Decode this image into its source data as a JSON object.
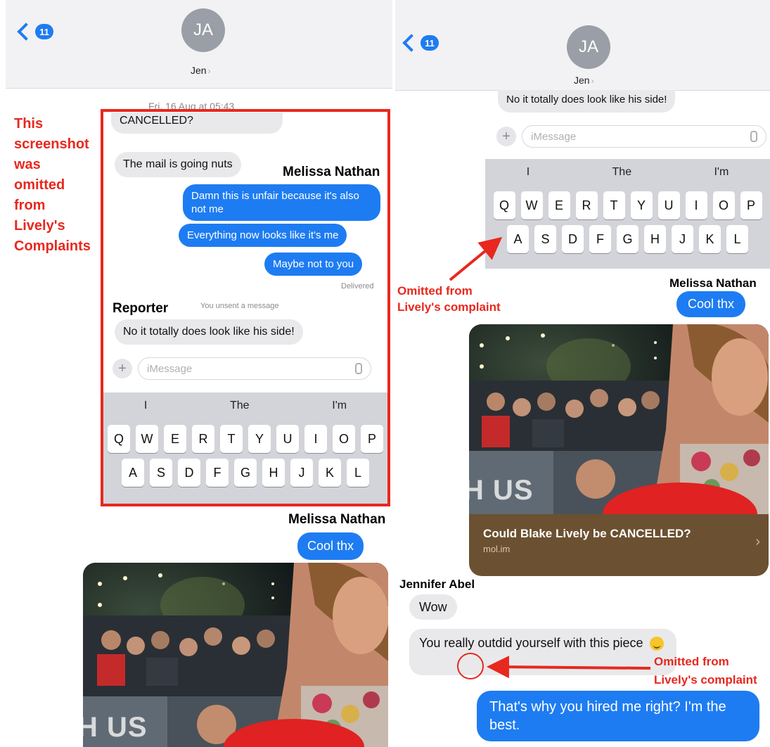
{
  "left": {
    "back_count": "11",
    "avatar_initials": "JA",
    "contact_name": "Jen",
    "timestamp": "Fri, 16 Aug at 05:43",
    "messages": {
      "cancelled": "CANCELLED?",
      "mail": "The mail is going nuts",
      "unfair": "Damn this is unfair because it's also not me",
      "everything": "Everything now looks like it's me",
      "maybe": "Maybe not to you",
      "delivered": "Delivered",
      "unsent": "You unsent a message",
      "totally": "No it totally does look like his side!",
      "cool": "Cool thx"
    },
    "compose_placeholder": "iMessage",
    "keyboard": {
      "suggestions": [
        "I",
        "The",
        "I'm"
      ],
      "row1": [
        "Q",
        "W",
        "E",
        "R",
        "T",
        "Y",
        "U",
        "I",
        "O",
        "P"
      ],
      "row2": [
        "A",
        "S",
        "D",
        "F",
        "G",
        "H",
        "J",
        "K",
        "L"
      ]
    },
    "photo_overlay": "H US"
  },
  "right": {
    "back_count": "11",
    "avatar_initials": "JA",
    "contact_name": "Jen",
    "messages": {
      "totally": "No it totally does look like his side!",
      "cool": "Cool thx",
      "wow": "Wow",
      "outdid": "You really outdid yourself with this piece",
      "hired": "That's why you hired  me right? I'm the best."
    },
    "compose_placeholder": "iMessage",
    "keyboard": {
      "suggestions": [
        "I",
        "The",
        "I'm"
      ],
      "row1": [
        "Q",
        "W",
        "E",
        "R",
        "T",
        "Y",
        "U",
        "I",
        "O",
        "P"
      ],
      "row2": [
        "A",
        "S",
        "D",
        "F",
        "G",
        "H",
        "J",
        "K",
        "L"
      ]
    },
    "link_card": {
      "title": "Could Blake Lively be CANCELLED?",
      "url": "mol.im"
    },
    "photo_overlay": "H US"
  },
  "annotations": {
    "left_note": [
      "This",
      "screenshot",
      "was",
      "omitted",
      "from",
      "Lively's",
      "Complaints"
    ],
    "melissa": "Melissa Nathan",
    "reporter": "Reporter",
    "jennifer": "Jennifer Abel",
    "omitted_1": [
      "Omitted from",
      "Lively's complaint"
    ],
    "omitted_2": [
      "Omitted from",
      "Lively's complaint"
    ]
  },
  "colors": {
    "imessage_blue": "#1e7cf2",
    "annotation_red": "#e8281e",
    "incoming_grey": "#e9e9eb",
    "card_brown": "#6b5131"
  },
  "icons": [
    "back-chevron-icon",
    "plus-icon",
    "mic-icon",
    "chevron-right-icon",
    "emoji-icon"
  ]
}
